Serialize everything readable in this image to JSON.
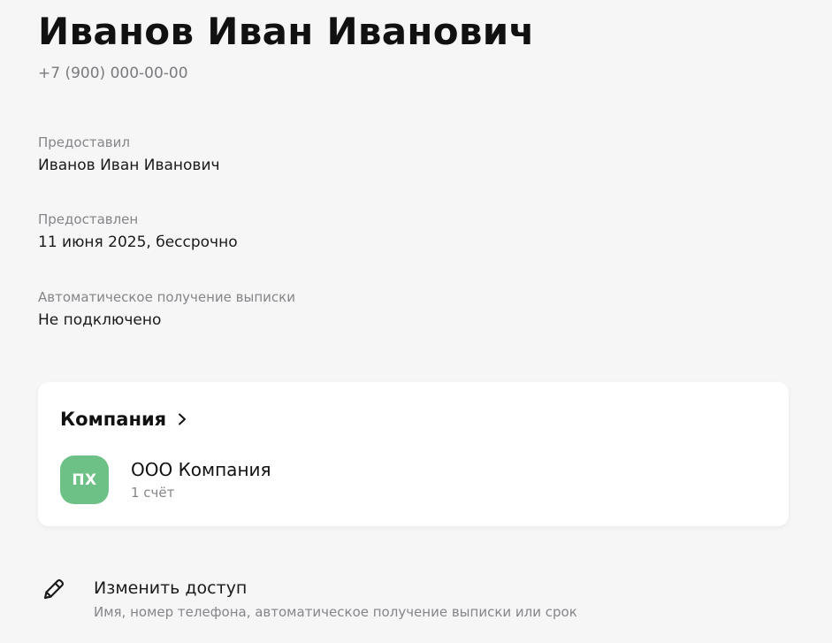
{
  "profile": {
    "name": "Иванов Иван Иванович",
    "phone": "+7 (900) 000-00-00"
  },
  "details": {
    "granted_by": {
      "label": "Предоставил",
      "value": "Иванов Иван Иванович"
    },
    "granted": {
      "label": "Предоставлен",
      "value": "11 июня 2025, бессрочно"
    },
    "auto_statement": {
      "label": "Автоматическое получение выписки",
      "value": "Не подключено"
    }
  },
  "company_card": {
    "title": "Компания",
    "company": {
      "initials": "ПХ",
      "name": "ООО Компания",
      "accounts": "1 счёт",
      "avatar_color": "#6ec186"
    }
  },
  "edit_access": {
    "icon": "pencil-icon",
    "title": "Изменить доступ",
    "subtitle": "Имя, номер телефона, автоматическое получение выписки или срок"
  },
  "colors": {
    "background": "#f6f6f7",
    "card": "#ffffff",
    "primary_text": "#1a1a1a",
    "secondary_text": "#85858a"
  }
}
